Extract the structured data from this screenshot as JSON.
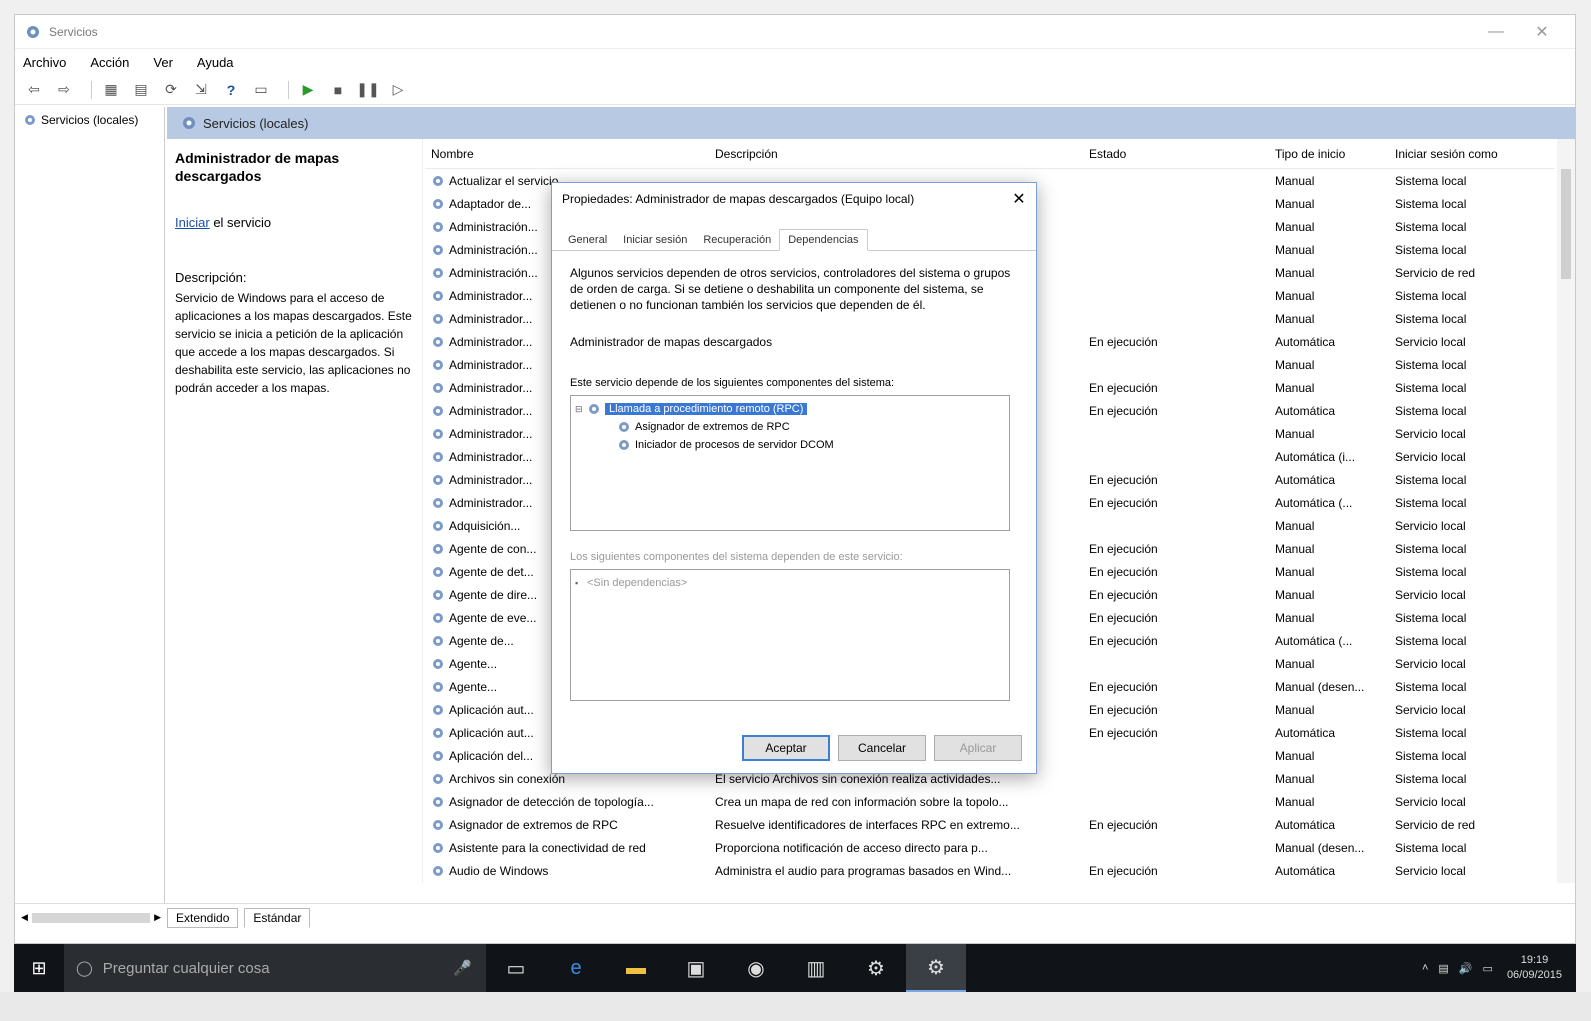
{
  "window": {
    "title": "Servicios",
    "minimize": "—",
    "close": "✕"
  },
  "menu": [
    "Archivo",
    "Acción",
    "Ver",
    "Ayuda"
  ],
  "tree": {
    "root": "Servicios (locales)"
  },
  "header_band": {
    "title": "Servicios (locales)"
  },
  "detail": {
    "title": "Administrador de mapas descargados",
    "link": "Iniciar",
    "link_suffix": "el servicio",
    "desc_label": "Descripción:",
    "desc": "Servicio de Windows para el acceso de aplicaciones a los mapas descargados. Este servicio se inicia a petición de la aplicación que accede a los mapas descargados. Si deshabilita este servicio, las aplicaciones no podrán acceder a los mapas."
  },
  "columns": {
    "name": "Nombre",
    "desc": "Descripción",
    "state": "Estado",
    "start": "Tipo de inicio",
    "logon": "Iniciar sesión como"
  },
  "rows": [
    {
      "name": "Actualizar el servicio...",
      "desc": "",
      "state": "",
      "start": "Manual",
      "logon": "Sistema local"
    },
    {
      "name": "Adaptador de...",
      "desc": "",
      "state": "",
      "start": "Manual",
      "logon": "Sistema local"
    },
    {
      "name": "Administración...",
      "desc": "",
      "state": "",
      "start": "Manual",
      "logon": "Sistema local"
    },
    {
      "name": "Administración...",
      "desc": "",
      "state": "",
      "start": "Manual",
      "logon": "Sistema local"
    },
    {
      "name": "Administración...",
      "desc": "",
      "state": "",
      "start": "Manual",
      "logon": "Servicio de red"
    },
    {
      "name": "Administrador...",
      "desc": "",
      "state": "",
      "start": "Manual",
      "logon": "Sistema local"
    },
    {
      "name": "Administrador...",
      "desc": "",
      "state": "",
      "start": "Manual",
      "logon": "Sistema local"
    },
    {
      "name": "Administrador...",
      "desc": "",
      "state": "En ejecución",
      "start": "Automática",
      "logon": "Servicio local"
    },
    {
      "name": "Administrador...",
      "desc": "",
      "state": "",
      "start": "Manual",
      "logon": "Sistema local"
    },
    {
      "name": "Administrador...",
      "desc": "",
      "state": "En ejecución",
      "start": "Manual",
      "logon": "Sistema local"
    },
    {
      "name": "Administrador...",
      "desc": "",
      "state": "En ejecución",
      "start": "Automática",
      "logon": "Sistema local"
    },
    {
      "name": "Administrador...",
      "desc": "",
      "state": "",
      "start": "Manual",
      "logon": "Servicio local"
    },
    {
      "name": "Administrador...",
      "desc": "",
      "state": "",
      "start": "Automática (i...",
      "logon": "Servicio local"
    },
    {
      "name": "Administrador...",
      "desc": "",
      "state": "En ejecución",
      "start": "Automática",
      "logon": "Sistema local"
    },
    {
      "name": "Administrador...",
      "desc": "",
      "state": "En ejecución",
      "start": "Automática (...",
      "logon": "Sistema local"
    },
    {
      "name": "Adquisición...",
      "desc": "",
      "state": "",
      "start": "Manual",
      "logon": "Servicio local"
    },
    {
      "name": "Agente de con...",
      "desc": "",
      "state": "En ejecución",
      "start": "Manual",
      "logon": "Sistema local"
    },
    {
      "name": "Agente de det...",
      "desc": "",
      "state": "En ejecución",
      "start": "Manual",
      "logon": "Sistema local"
    },
    {
      "name": "Agente de dire...",
      "desc": "",
      "state": "En ejecución",
      "start": "Manual",
      "logon": "Servicio local"
    },
    {
      "name": "Agente de eve...",
      "desc": "",
      "state": "En ejecución",
      "start": "Manual",
      "logon": "Sistema local"
    },
    {
      "name": "Agente de...",
      "desc": "",
      "state": "En ejecución",
      "start": "Automática (...",
      "logon": "Sistema local"
    },
    {
      "name": "Agente...",
      "desc": "",
      "state": "",
      "start": "Manual",
      "logon": "Servicio local"
    },
    {
      "name": "Agente...",
      "desc": "",
      "state": "En ejecución",
      "start": "Manual (desen...",
      "logon": "Sistema local"
    },
    {
      "name": "Aplicación aut...",
      "desc": "",
      "state": "En ejecución",
      "start": "Manual",
      "logon": "Servicio local"
    },
    {
      "name": "Aplicación aut...",
      "desc": "",
      "state": "En ejecución",
      "start": "Automática",
      "logon": "Sistema local"
    },
    {
      "name": "Aplicación del...",
      "desc": "",
      "state": "",
      "start": "Manual",
      "logon": "Sistema local"
    },
    {
      "name": "Archivos sin conexión",
      "desc": "El servicio Archivos sin conexión realiza actividades...",
      "state": "",
      "start": "Manual",
      "logon": "Sistema local"
    },
    {
      "name": "Asignador de detección de topología...",
      "desc": "Crea un mapa de red con información sobre la topolo...",
      "state": "",
      "start": "Manual",
      "logon": "Servicio local"
    },
    {
      "name": "Asignador de extremos de RPC",
      "desc": "Resuelve identificadores de interfaces RPC en extremo...",
      "state": "En ejecución",
      "start": "Automática",
      "logon": "Servicio de red"
    },
    {
      "name": "Asistente para la conectividad de red",
      "desc": "Proporciona notificación de acceso directo para p...",
      "state": "",
      "start": "Manual (desen...",
      "logon": "Sistema local"
    },
    {
      "name": "Audio de Windows",
      "desc": "Administra el audio para programas basados en Wind...",
      "state": "En ejecución",
      "start": "Automática",
      "logon": "Servicio local"
    }
  ],
  "view_tabs": [
    "Extendido",
    "Estándar"
  ],
  "dialog": {
    "title": "Propiedades: Administrador de mapas descargados (Equipo local)",
    "tabs": [
      "General",
      "Iniciar sesión",
      "Recuperación",
      "Dependencias"
    ],
    "active_tab": 3,
    "intro": "Algunos servicios dependen de otros servicios, controladores del sistema o grupos de orden de carga. Si se detiene o deshabilita un componente del sistema, se detienen o no funcionan también los servicios que dependen de él.",
    "service_line": "Administrador de mapas descargados",
    "group1_label": "Este servicio depende de los siguientes componentes del sistema:",
    "deps": [
      {
        "label": "Llamada a procedimiento remoto (RPC)",
        "selected": true,
        "child": false
      },
      {
        "label": "Asignador de extremos de RPC",
        "selected": false,
        "child": true
      },
      {
        "label": "Iniciador de procesos de servidor DCOM",
        "selected": false,
        "child": true
      }
    ],
    "group2_label": "Los siguientes componentes del sistema dependen de este servicio:",
    "none_dep": "<Sin dependencias>",
    "btn_ok": "Aceptar",
    "btn_cancel": "Cancelar",
    "btn_apply": "Aplicar"
  },
  "taskbar": {
    "search_placeholder": "Preguntar cualquier cosa",
    "time": "19:19",
    "date": "06/09/2015"
  }
}
